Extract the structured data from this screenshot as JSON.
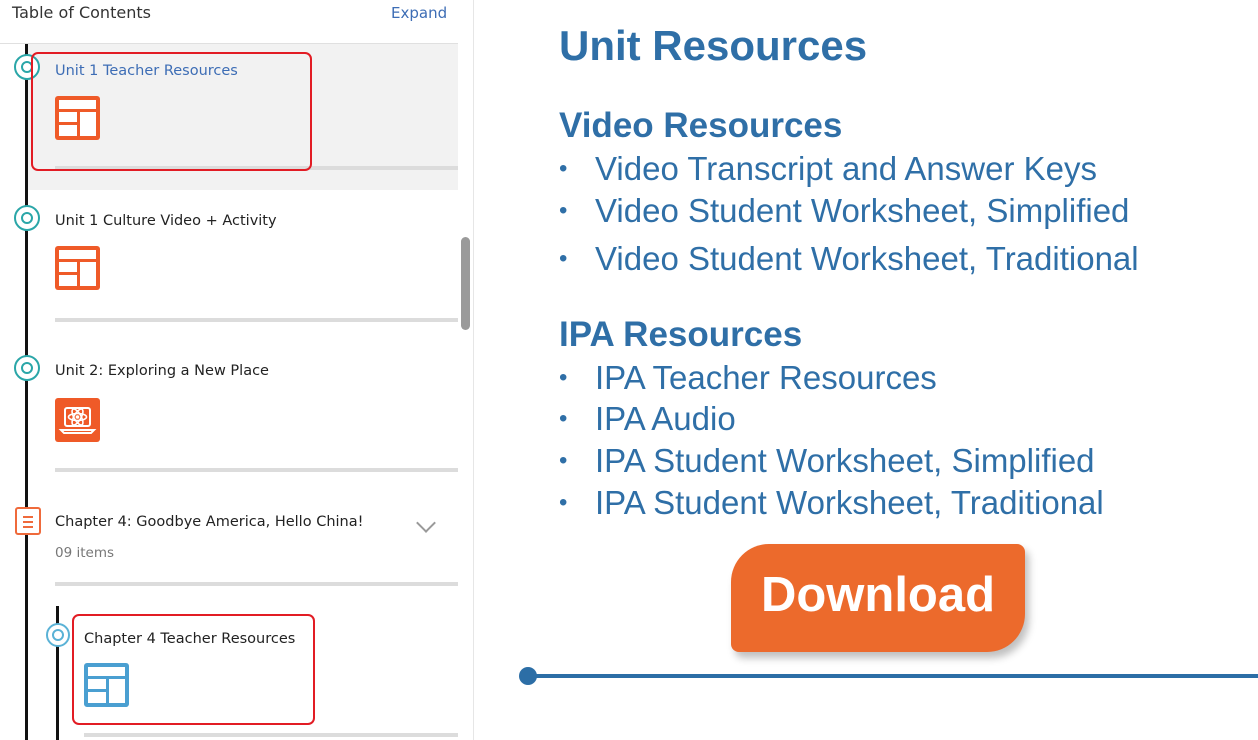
{
  "toc": {
    "title": "Table of Contents",
    "expand_label": "Expand",
    "items": [
      {
        "label": "Unit 1 Teacher Resources",
        "icon": "layout-grid-icon",
        "state": "active"
      },
      {
        "label": "Unit 1 Culture Video + Activity",
        "icon": "layout-grid-icon"
      },
      {
        "label": "Unit 2: Exploring a New Place",
        "icon": "atom-laptop-icon"
      },
      {
        "label": "Chapter 4: Goodbye America, Hello China!",
        "sub": "09 items",
        "icon": "document-list-icon"
      },
      {
        "label": "Chapter 4 Teacher Resources",
        "icon": "layout-grid-icon"
      }
    ]
  },
  "content": {
    "title": "Unit Resources",
    "sections": [
      {
        "heading": "Video Resources",
        "items": [
          "Video Transcript and Answer Keys",
          "Video Student Worksheet, Simplified",
          "Video Student Worksheet, Traditional"
        ]
      },
      {
        "heading": "IPA Resources",
        "items": [
          "IPA Teacher Resources",
          "IPA Audio",
          "IPA Student Worksheet, Simplified",
          "IPA Student Worksheet, Traditional"
        ]
      }
    ],
    "bullet": "•",
    "download_label": "Download"
  },
  "colors": {
    "heading_blue": "#2f6fa7",
    "accent_orange": "#ec6a2c",
    "link_blue": "#3d6db5",
    "highlight_red": "#e21c24",
    "node_teal": "#2aa6a8"
  }
}
